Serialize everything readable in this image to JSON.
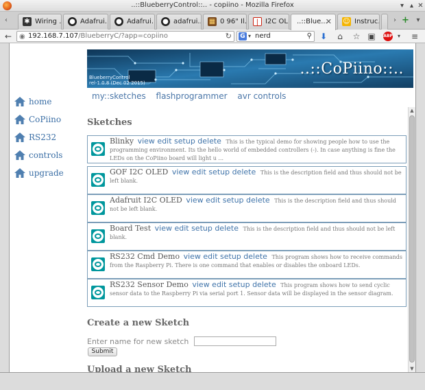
{
  "window": {
    "title": "..::BlueberryControl::.. - copiino - Mozilla Firefox"
  },
  "tabs": [
    {
      "label": "Wiring ...",
      "icon": "wiring-icon"
    },
    {
      "label": "Adafrui...",
      "icon": "github-icon"
    },
    {
      "label": "Adafrui...",
      "icon": "github-icon"
    },
    {
      "label": "adafrui...",
      "icon": "github-icon"
    },
    {
      "label": "0 96\" Il...",
      "icon": "shop-icon"
    },
    {
      "label": "I2C OL...",
      "icon": "tab-i2c-icon"
    },
    {
      "label": "..::Blue...",
      "icon": "raspberry-icon",
      "active": true
    },
    {
      "label": "Instruc...",
      "icon": "instructables-icon"
    }
  ],
  "navbar": {
    "url_host": "192.168.7.107",
    "url_path": "/BlueberryC/?app=copiino",
    "search_value": "nerd",
    "search_engine": "G"
  },
  "page": {
    "banner": {
      "title": "..::CoPiino::..",
      "subtitle_line1": "BlueberryControl",
      "subtitle_line2": "rel-1.0.8 (Dec 02 2015)"
    },
    "topnav": [
      "my::sketches",
      "flashprogrammer",
      "avr controls"
    ],
    "sidenav": [
      "home",
      "CoPiino",
      "RS232",
      "controls",
      "upgrade"
    ],
    "sketches_heading": "Sketches",
    "sketch_actions": "view edit setup delete",
    "sketches": [
      {
        "name": "Blinky",
        "description": "This is the typical demo for showing people how to use the programming environment. Its the hello world of embedded controllers (-). In case anything is fine the LEDs on the CoPiino board will light u ..."
      },
      {
        "name": "GOF I2C OLED",
        "description": "This is the description field and thus should not be left blank."
      },
      {
        "name": "Adafruit I2C OLED",
        "description": "This is the description field and thus should not be left blank."
      },
      {
        "name": "Board Test",
        "description": "This is the description field and thus should not be left blank."
      },
      {
        "name": "RS232 Cmd Demo",
        "description": "This program shows how to receive commands from the Raspberry Pi. There is one command that enables or disables the onboard LEDs."
      },
      {
        "name": "RS232 Sensor Demo",
        "description": "This program shows how to send cyclic sensor data to the Raspberry Pi via serial port 1. Sensor data will be displayed in the sensor diagram."
      }
    ],
    "create_heading": "Create a new Sketch",
    "create_label": "Enter name for new sketch",
    "create_value": "",
    "submit_label": "Submit",
    "upload_heading": "Upload a new Sketch"
  }
}
